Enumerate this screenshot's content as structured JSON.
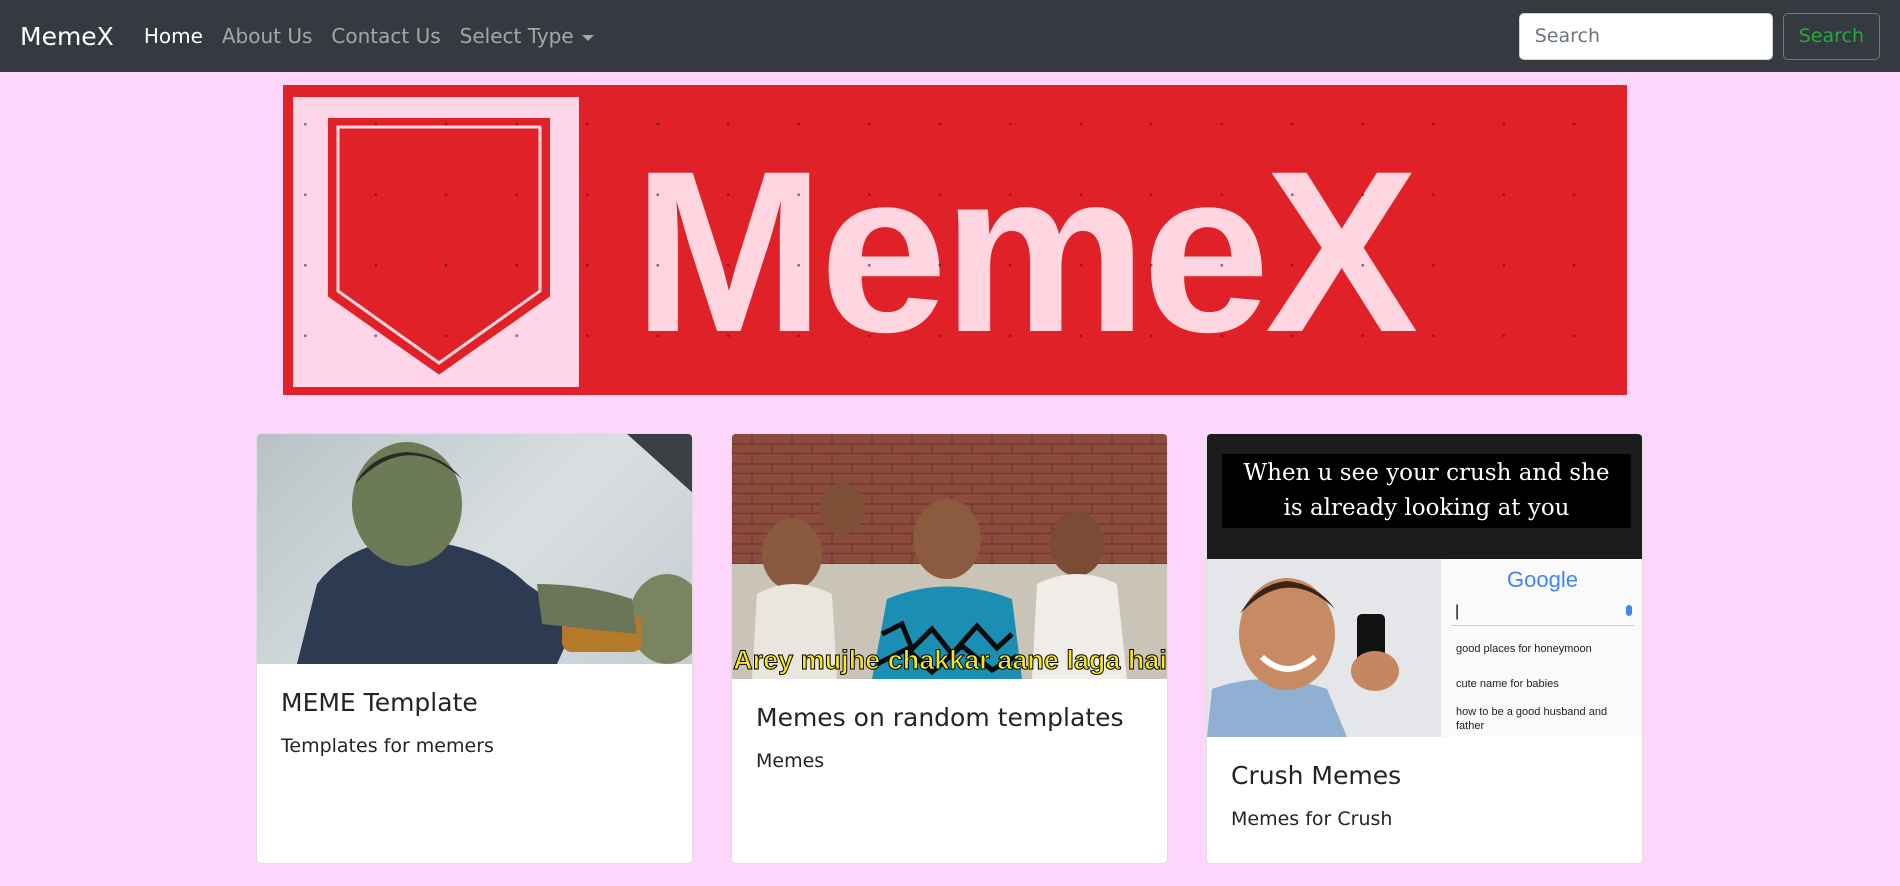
{
  "navbar": {
    "brand": "MemeX",
    "links": [
      {
        "label": "Home"
      },
      {
        "label": "About Us"
      },
      {
        "label": "Contact Us"
      },
      {
        "label": "Select Type"
      }
    ],
    "search_placeholder": "Search",
    "search_button": "Search"
  },
  "banner": {
    "text": "MemeX",
    "colors": {
      "background": "#e02127",
      "foreground": "#ffd6e0"
    }
  },
  "cards": [
    {
      "title": "MEME Template",
      "text": "Templates for memers",
      "image": "hulk-template-image"
    },
    {
      "title": "Memes on random templates",
      "text": "Memes",
      "image": "crowd-meme-image",
      "caption": "Arey mujhe chakkar aane laga hai"
    },
    {
      "title": "Crush Memes",
      "text": "Memes for Crush",
      "image": "crush-meme-image",
      "meme_top": "When u see your crush and she is already looking at you",
      "google_label": "Google",
      "suggestions": [
        "good places for honeymoon",
        "cute name for babies",
        "how to be a good husband and father"
      ]
    }
  ],
  "colors": {
    "page_bg": "#ffd6fb",
    "navbar_bg": "#343a40",
    "success": "#28a745"
  }
}
